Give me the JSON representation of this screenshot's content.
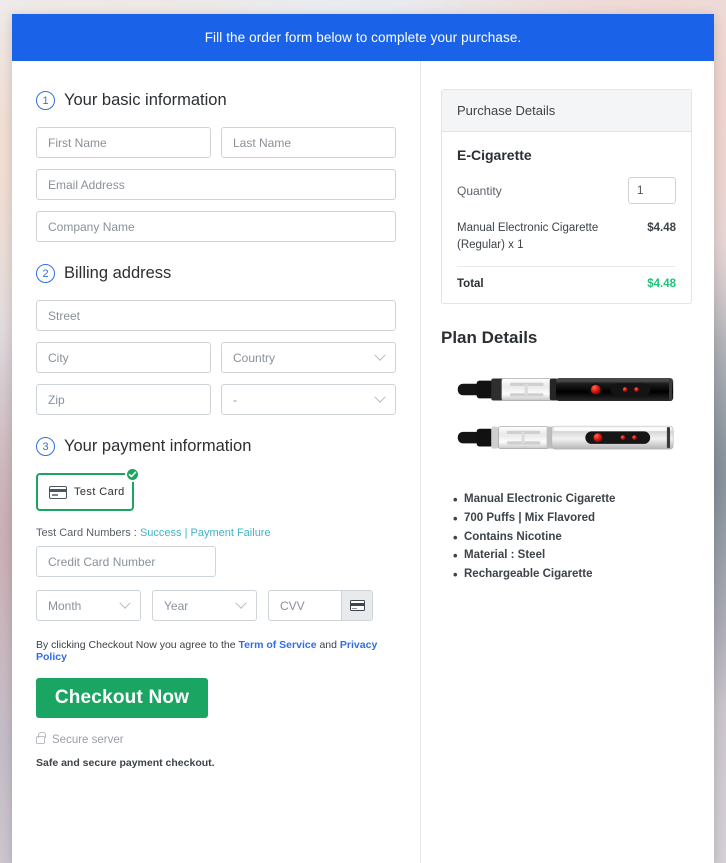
{
  "banner": {
    "text": "Fill the order form below to complete your purchase."
  },
  "sections": {
    "basic": {
      "number": "1",
      "title": "Your basic information",
      "fields": {
        "first_name": "First Name",
        "last_name": "Last Name",
        "email": "Email Address",
        "company": "Company Name"
      }
    },
    "billing": {
      "number": "2",
      "title": "Billing address",
      "fields": {
        "street": "Street",
        "city": "City",
        "country": "Country",
        "zip": "Zip",
        "state": "-"
      }
    },
    "payment": {
      "number": "3",
      "title": "Your payment information",
      "card_option_label": "Test  Card",
      "test_numbers_label": "Test Card Numbers :",
      "test_success_link": "Success",
      "test_separator": "|",
      "test_failure_link": "Payment Failure",
      "card_number": "Credit Card Number",
      "month": "Month",
      "year": "Year",
      "cvv": "CVV"
    }
  },
  "footer": {
    "terms_prefix": "By clicking Checkout Now you agree to the",
    "terms_link": "Term of Service",
    "terms_and": "and",
    "privacy_link": "Privacy Policy",
    "checkout_label": "Checkout Now",
    "secure_server": "Secure server",
    "safe_note": "Safe and secure payment checkout."
  },
  "purchase": {
    "header": "Purchase Details",
    "product_name": "E-Cigarette",
    "quantity_label": "Quantity",
    "quantity_value": "1",
    "line_item": "Manual Electronic Cigarette (Regular) x 1",
    "line_amount": "$4.48",
    "total_label": "Total",
    "total_amount": "$4.48"
  },
  "plan": {
    "title": "Plan Details",
    "features": [
      "Manual Electronic Cigarette",
      "700 Puffs | Mix Flavored",
      "Contains Nicotine",
      "Material : Steel",
      "Rechargeable Cigarette"
    ]
  },
  "colors": {
    "banner_blue": "#1a62e8",
    "accent_blue": "#2f6fe4",
    "green": "#1aa563",
    "total_green": "#1ec37a",
    "link_teal": "#3bb5c9"
  }
}
